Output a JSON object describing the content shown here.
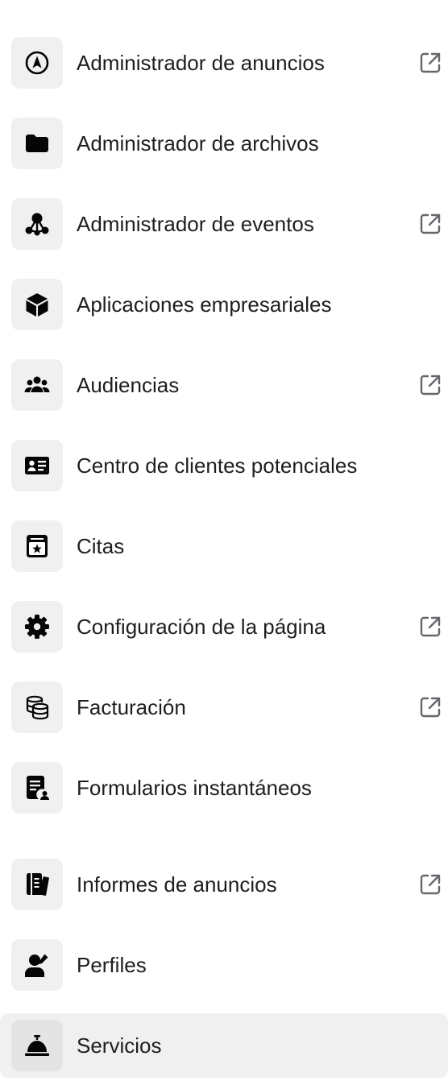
{
  "menu": {
    "items": [
      {
        "label": "Administrador de anuncios",
        "icon": "navigation-arrow-icon",
        "external_link": true,
        "selected": false
      },
      {
        "label": "Administrador de archivos",
        "icon": "folder-icon",
        "external_link": false,
        "selected": false
      },
      {
        "label": "Administrador de eventos",
        "icon": "network-nodes-icon",
        "external_link": true,
        "selected": false
      },
      {
        "label": "Aplicaciones empresariales",
        "icon": "cube-icon",
        "external_link": false,
        "selected": false
      },
      {
        "label": "Audiencias",
        "icon": "people-group-icon",
        "external_link": true,
        "selected": false
      },
      {
        "label": "Centro de clientes potenciales",
        "icon": "contact-card-icon",
        "external_link": false,
        "selected": false
      },
      {
        "label": "Citas",
        "icon": "calendar-star-icon",
        "external_link": false,
        "selected": false
      },
      {
        "label": "Configuración de la página",
        "icon": "gear-icon",
        "external_link": true,
        "selected": false
      },
      {
        "label": "Facturación",
        "icon": "coin-stack-icon",
        "external_link": true,
        "selected": false
      },
      {
        "label": "Formularios instantáneos",
        "icon": "form-person-icon",
        "external_link": false,
        "selected": false
      },
      {
        "label": "Informes de anuncios",
        "icon": "reports-icon",
        "external_link": true,
        "selected": false
      },
      {
        "label": "Perfiles",
        "icon": "person-edit-icon",
        "external_link": false,
        "selected": false
      },
      {
        "label": "Servicios",
        "icon": "service-bell-icon",
        "external_link": false,
        "selected": true
      }
    ],
    "external_link_icon": "external-link-icon"
  },
  "colors": {
    "text": "#1c1e21",
    "icon": "#050505",
    "icon_background": "#f0f0f0",
    "selected_background": "#f0f0f0",
    "external_link_icon": "#65676b"
  }
}
